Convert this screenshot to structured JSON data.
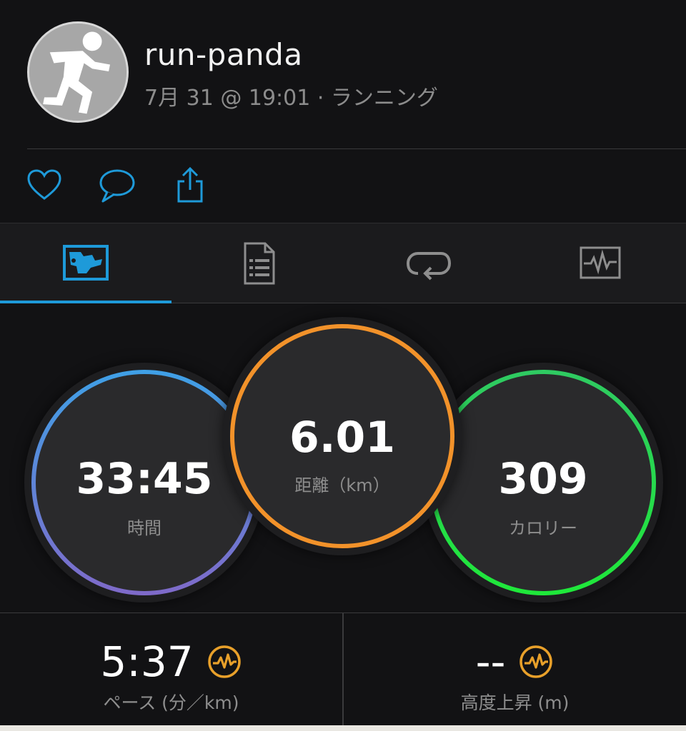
{
  "header": {
    "username": "run-panda",
    "subtitle": "7月 31 @ 19:01 · ランニング"
  },
  "icons": {
    "avatar": "running-person-icon",
    "like": "heart-icon",
    "comment": "speech-bubble-icon",
    "share": "share-icon",
    "tab_overview": "overview-map-icon",
    "tab_stats": "stats-list-icon",
    "tab_laps": "laps-loop-icon",
    "tab_charts": "chart-icon",
    "badge": "activity-pulse-icon"
  },
  "colors": {
    "accent": "#1e9ad9",
    "time_ring_start": "#3fa0e6",
    "time_ring_end": "#7f6ac9",
    "distance_ring": "#f2922a",
    "calorie_ring": "#2fca62",
    "badge": "#e8a02a"
  },
  "metrics": {
    "time": {
      "value": "33:45",
      "label": "時間"
    },
    "distance": {
      "value": "6.01",
      "label": "距離（km）"
    },
    "calories": {
      "value": "309",
      "label": "カロリー"
    }
  },
  "stats": {
    "pace": {
      "value": "5:37",
      "label": "ペース (分／km)"
    },
    "elevation": {
      "value": "--",
      "label": "高度上昇 (m)"
    }
  }
}
